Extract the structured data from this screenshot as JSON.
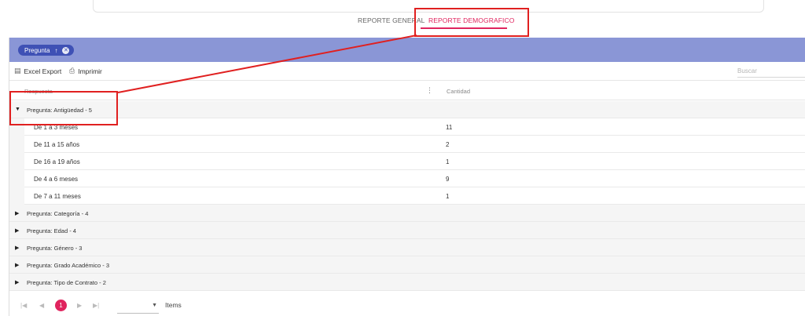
{
  "tabs": [
    {
      "label": "REPORTE GENERAL",
      "active": false
    },
    {
      "label": "REPORTE DEMOGRAFICO",
      "active": true
    }
  ],
  "group_chip": {
    "label": "Pregunta",
    "sort_icon": "arrow-up-icon",
    "remove_icon": "close-circle-icon"
  },
  "toolbar": {
    "excel_label": "Excel Export",
    "print_label": "Imprimir",
    "search_placeholder": "Buscar"
  },
  "columns": {
    "respuesta": "Respuesta",
    "cantidad": "Cantidad"
  },
  "expanded_group": {
    "title": "Pregunta: Antigüedad - 5",
    "rows": [
      {
        "respuesta": "De 1 a 3 meses",
        "cantidad": "11"
      },
      {
        "respuesta": "De 11 a 15 años",
        "cantidad": "2"
      },
      {
        "respuesta": "De 16 a 19 años",
        "cantidad": "1"
      },
      {
        "respuesta": "De 4 a 6 meses",
        "cantidad": "9"
      },
      {
        "respuesta": "De 7 a 11 meses",
        "cantidad": "1"
      }
    ]
  },
  "collapsed_groups": [
    "Pregunta: Categoría - 4",
    "Pregunta: Edad - 4",
    "Pregunta: Género - 3",
    "Pregunta: Grado Académico - 3",
    "Pregunta: Tipo de Contrato - 2"
  ],
  "pager": {
    "current_page": "1",
    "items_label": "Items"
  },
  "colors": {
    "accent": "#e0245e",
    "group_bar": "#8a96d6",
    "chip": "#3f51b5",
    "annotation": "#e02020"
  }
}
